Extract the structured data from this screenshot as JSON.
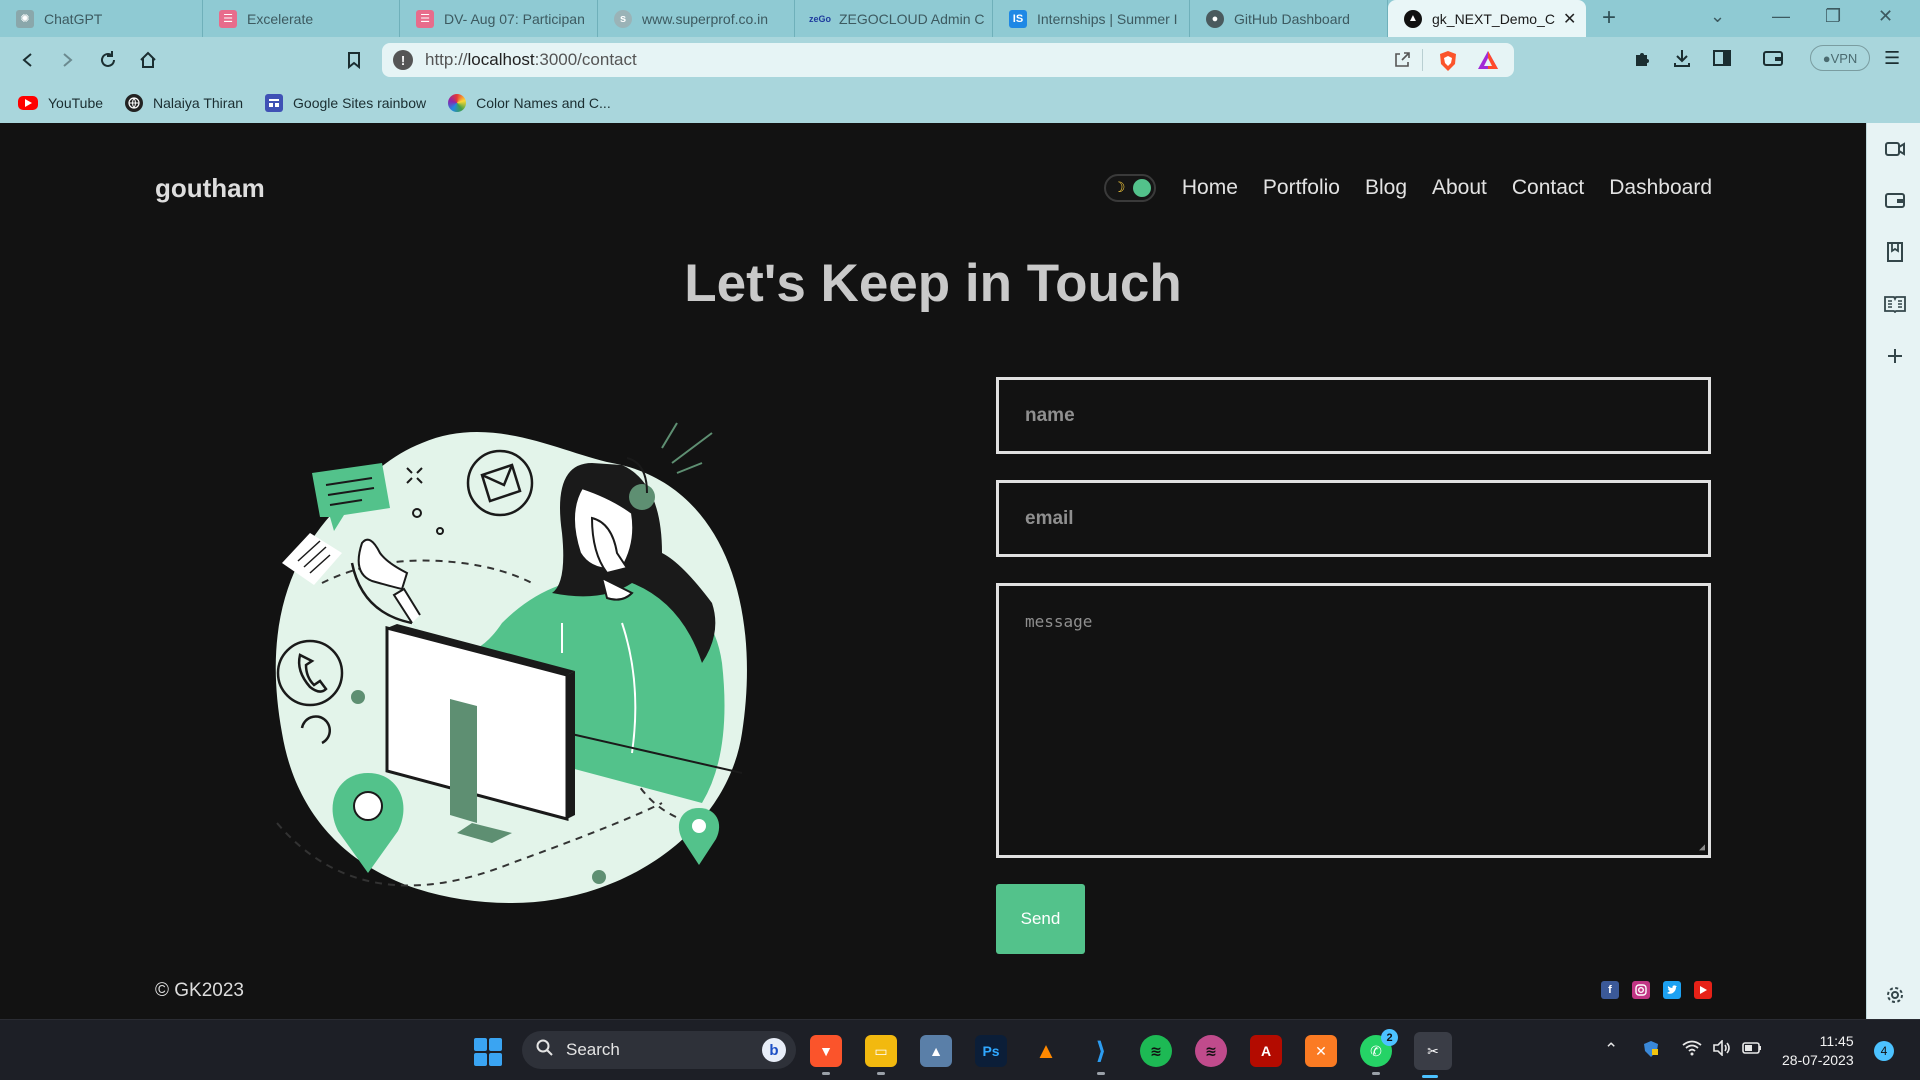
{
  "browser": {
    "tabs": [
      {
        "title": "ChatGPT",
        "icon": "chatgpt-icon"
      },
      {
        "title": "Excelerate",
        "icon": "excelerate-icon"
      },
      {
        "title": "DV- Aug 07: Participan",
        "icon": "sheet-icon"
      },
      {
        "title": "www.superprof.co.in",
        "icon": "superprof-icon"
      },
      {
        "title": "ZEGOCLOUD Admin C",
        "icon": "zego-icon"
      },
      {
        "title": "Internships | Summer I",
        "icon": "internshala-icon"
      },
      {
        "title": "GitHub Dashboard",
        "icon": "github-icon"
      },
      {
        "title": "gk_NEXT_Demo_C",
        "icon": "nextjs-icon",
        "active": true
      }
    ],
    "url_prefix": "http://",
    "url_host": "localhost",
    "url_path": ":3000/contact",
    "vpn_label": "VPN",
    "bookmarks": [
      {
        "label": "YouTube",
        "icon": "youtube-icon"
      },
      {
        "label": "Nalaiya Thiran",
        "icon": "globe-icon"
      },
      {
        "label": "Google Sites rainbow",
        "icon": "google-sites-icon"
      },
      {
        "label": "Color Names and C...",
        "icon": "color-wheel-icon"
      }
    ]
  },
  "site": {
    "logo": "goutham",
    "nav": [
      "Home",
      "Portfolio",
      "Blog",
      "About",
      "Contact",
      "Dashboard"
    ],
    "heading": "Let's Keep in Touch",
    "form": {
      "name_placeholder": "name",
      "email_placeholder": "email",
      "message_placeholder": "message",
      "send_label": "Send"
    },
    "footer": {
      "copyright": "© GK2023",
      "socials": [
        "facebook-icon",
        "instagram-icon",
        "twitter-icon",
        "youtube-icon"
      ]
    },
    "colors": {
      "accent": "#53c28b",
      "background": "#121212"
    }
  },
  "taskbar": {
    "search_label": "Search",
    "whatsapp_badge": "2",
    "time": "11:45",
    "date": "28-07-2023",
    "notifications": "4"
  }
}
